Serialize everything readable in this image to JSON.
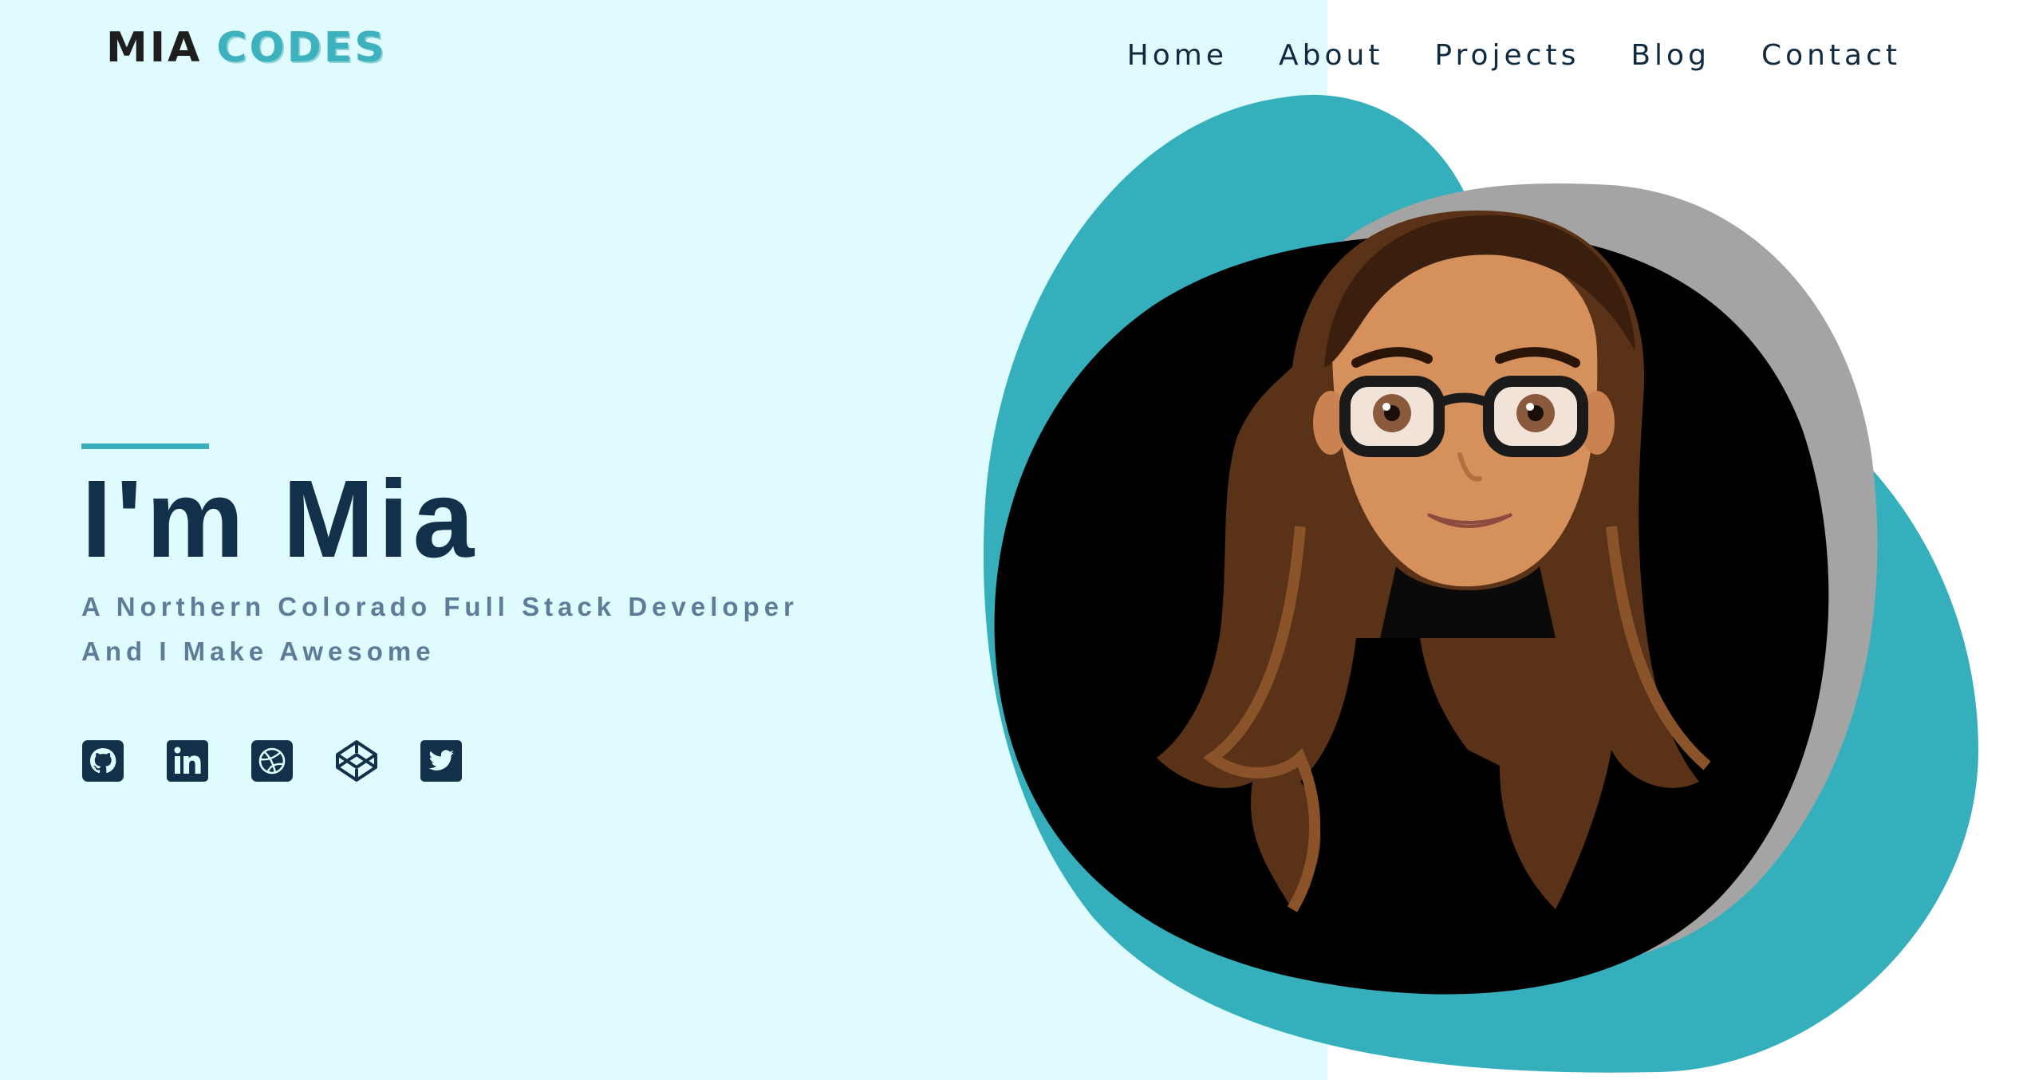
{
  "brand": {
    "logo_part1": "MIA",
    "logo_part2": "CODES"
  },
  "nav": {
    "items": [
      {
        "label": "Home"
      },
      {
        "label": "About"
      },
      {
        "label": "Projects"
      },
      {
        "label": "Blog"
      },
      {
        "label": "Contact"
      }
    ]
  },
  "hero": {
    "title": "I'm Mia",
    "subtitle_line1": "A Northern Colorado Full Stack Developer",
    "subtitle_line2": "And I Make Awesome"
  },
  "socials": [
    {
      "icon": "github-icon"
    },
    {
      "icon": "linkedin-icon"
    },
    {
      "icon": "dribbble-icon"
    },
    {
      "icon": "codepen-icon"
    },
    {
      "icon": "twitter-icon"
    }
  ],
  "colors": {
    "left_panel": "#e0fbfd",
    "accent": "#3aaebb",
    "navy": "#12304a",
    "muted": "#5e7c97",
    "blob_gray": "#a4a4a4"
  }
}
